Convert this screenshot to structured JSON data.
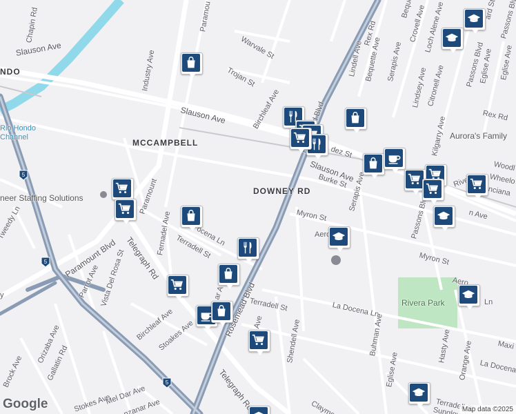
{
  "map": {
    "logo": "Google",
    "attribution": "Map data ©2025",
    "colors": {
      "land": "#f1f0f3",
      "road": "#ffffff",
      "highway": "#8a9bb4",
      "water": "#8fd9ea",
      "park": "#bfe6c2",
      "marker": "#1d4a7a"
    }
  },
  "labels": [
    {
      "id": "slauson-ave-w",
      "text": "Slauson Ave"
    },
    {
      "id": "chapin-rd",
      "text": "Chapin Rd"
    },
    {
      "id": "ndo",
      "text": "NDO"
    },
    {
      "id": "industry-ave",
      "text": "Industry Ave"
    },
    {
      "id": "paramount-n",
      "text": "Paramou"
    },
    {
      "id": "warvale-st",
      "text": "Warvale St"
    },
    {
      "id": "trojan-st",
      "text": "Trojan St"
    },
    {
      "id": "birchleaf-ave-n",
      "text": "Birchleaf Ave"
    },
    {
      "id": "slauson-ave-mid",
      "text": "Slauson Ave"
    },
    {
      "id": "mccampbell",
      "text": "MCCAMPBELL"
    },
    {
      "id": "rio-hondo-channel-1",
      "text": "Rio Hondo"
    },
    {
      "id": "rio-hondo-channel-2",
      "text": "Channel"
    },
    {
      "id": "paramount-mid",
      "text": "Paramount"
    },
    {
      "id": "staffing",
      "text": "neer Staffing Solutions"
    },
    {
      "id": "downey-rd",
      "text": "DOWNEY RD"
    },
    {
      "id": "burke-st",
      "text": "Burke St"
    },
    {
      "id": "slauson-ave-e",
      "text": "Slauson Ave"
    },
    {
      "id": "myron-st",
      "text": "Myron St"
    },
    {
      "id": "myron-st-e",
      "text": "Myron St"
    },
    {
      "id": "tweedy-ln",
      "text": "Tweedy Ln"
    },
    {
      "id": "paramount-blvd",
      "text": "Paramount Blvd"
    },
    {
      "id": "fernadel-ave",
      "text": "Fernadel Ave"
    },
    {
      "id": "telegraph-rd-n",
      "text": "Telegraph Rd"
    },
    {
      "id": "terradell-st-w",
      "text": "Terradell St"
    },
    {
      "id": "la-docena-ln-w",
      "text": "ocena Ln"
    },
    {
      "id": "parrot-ave",
      "text": "Parrot Ave"
    },
    {
      "id": "vista-del-rosa",
      "text": "Vista Del Rosa St"
    },
    {
      "id": "terradell-st",
      "text": "Terradell St"
    },
    {
      "id": "la-docena-ln",
      "text": "La Docena Ln"
    },
    {
      "id": "rivera-park",
      "text": "Rivera Park"
    },
    {
      "id": "orizaba-ave",
      "text": "Orizaba Ave"
    },
    {
      "id": "gallatin-rd",
      "text": "Gallatin Rd"
    },
    {
      "id": "brock-ave",
      "text": "Brock Ave"
    },
    {
      "id": "birchleaf-ave-s",
      "text": "Birchleaf Ave"
    },
    {
      "id": "stoakes-ave",
      "text": "Stoakes Ave"
    },
    {
      "id": "stokes-ave",
      "text": "Stokes Ave"
    },
    {
      "id": "mel-dar-ave",
      "text": "Mel Dar Ave"
    },
    {
      "id": "manzanar-ave",
      "text": "nzanar Ave"
    },
    {
      "id": "telegraph-rd-s",
      "text": "Telegraph Rd"
    },
    {
      "id": "shendell-ave",
      "text": "Shendell Ave"
    },
    {
      "id": "rosemead-blvd",
      "text": "Rosemead Blvd"
    },
    {
      "id": "serapis-ave",
      "text": "Serapis Ave"
    },
    {
      "id": "passons-blvd",
      "text": "Passons Blvd"
    },
    {
      "id": "passons-blvd-2",
      "text": "Passons Blvd"
    },
    {
      "id": "buhman-ave",
      "text": "Buhman Ave"
    },
    {
      "id": "eglise-ave",
      "text": "Eglise Ave"
    },
    {
      "id": "eglise-ave-2",
      "text": "Eglise Ave"
    },
    {
      "id": "hasty-ave",
      "text": "Hasty Ave"
    },
    {
      "id": "orange-ave",
      "text": "Orange Ave"
    },
    {
      "id": "la-docena-e",
      "text": "La Docena"
    },
    {
      "id": "maxi",
      "text": "Maxi"
    },
    {
      "id": "terradell-st-e",
      "text": "Terradell St"
    },
    {
      "id": "sunglow",
      "text": "Sunglov"
    },
    {
      "id": "claymo",
      "text": "Claymo"
    },
    {
      "id": "aurora",
      "text": "Aurora's Family"
    },
    {
      "id": "rex-rd",
      "text": "Rex Rd"
    },
    {
      "id": "rex-rd-e",
      "text": "Rex Rd"
    },
    {
      "id": "lindell-ave",
      "text": "Lindell Ave"
    },
    {
      "id": "bequette-ave",
      "text": "Bequette Ave"
    },
    {
      "id": "bequette-ave-2",
      "text": "Bequette"
    },
    {
      "id": "serapis-ave-n",
      "text": "Serapis Ave"
    },
    {
      "id": "crovell-ave",
      "text": "Crovell Ave"
    },
    {
      "id": "loch-alene-ave",
      "text": "Loch Alene Ave"
    },
    {
      "id": "lindsey-ave",
      "text": "Lindsey Ave"
    },
    {
      "id": "citronell-ave",
      "text": "Citronell Ave"
    },
    {
      "id": "kilgarry-ave",
      "text": "Kilgarry Ave"
    },
    {
      "id": "passons-blvd-n",
      "text": "Passons Blvd"
    },
    {
      "id": "eglise-ave-n",
      "text": "Eglise Ave"
    },
    {
      "id": "woodl",
      "text": "Woodl"
    },
    {
      "id": "wheelo",
      "text": "Wheelo"
    },
    {
      "id": "rivera-rd",
      "text": "River"
    },
    {
      "id": "inciana",
      "text": "nciana"
    },
    {
      "id": "fernandez",
      "text": "dez St"
    },
    {
      "id": "aero",
      "text": "Aero"
    },
    {
      "id": "aero-e",
      "text": "Aero"
    },
    {
      "id": "ln",
      "text": "Ln"
    },
    {
      "id": "ard-st",
      "text": "ard St"
    },
    {
      "id": "rosemead-n",
      "text": "Rosemead Blvd"
    },
    {
      "id": "n-ave",
      "text": "n Ave"
    },
    {
      "id": "ar-a",
      "text": "ar A"
    },
    {
      "id": "s-ave",
      "text": "Ave"
    },
    {
      "id": "y",
      "text": "y"
    }
  ],
  "markers": [
    {
      "icon": "shopping-bag"
    },
    {
      "icon": "school"
    },
    {
      "icon": "school"
    },
    {
      "icon": "restaurant"
    },
    {
      "icon": "shopping-cart"
    },
    {
      "icon": "shopping-cart"
    },
    {
      "icon": "restaurant"
    },
    {
      "icon": "shopping-bag"
    },
    {
      "icon": "shopping-bag"
    },
    {
      "icon": "coffee"
    },
    {
      "icon": "shopping-cart"
    },
    {
      "icon": "shopping-cart"
    },
    {
      "icon": "shopping-cart"
    },
    {
      "icon": "shopping-cart"
    },
    {
      "icon": "school"
    },
    {
      "icon": "school"
    },
    {
      "icon": "shopping-cart"
    },
    {
      "icon": "shopping-cart"
    },
    {
      "icon": "shopping-bag"
    },
    {
      "icon": "restaurant"
    },
    {
      "icon": "shopping-bag"
    },
    {
      "icon": "shopping-cart"
    },
    {
      "icon": "coffee"
    },
    {
      "icon": "shopping-bag"
    },
    {
      "icon": "shopping-cart"
    },
    {
      "icon": "school"
    },
    {
      "icon": "school"
    },
    {
      "icon": "shopping-cart"
    },
    {
      "icon": "school"
    }
  ]
}
